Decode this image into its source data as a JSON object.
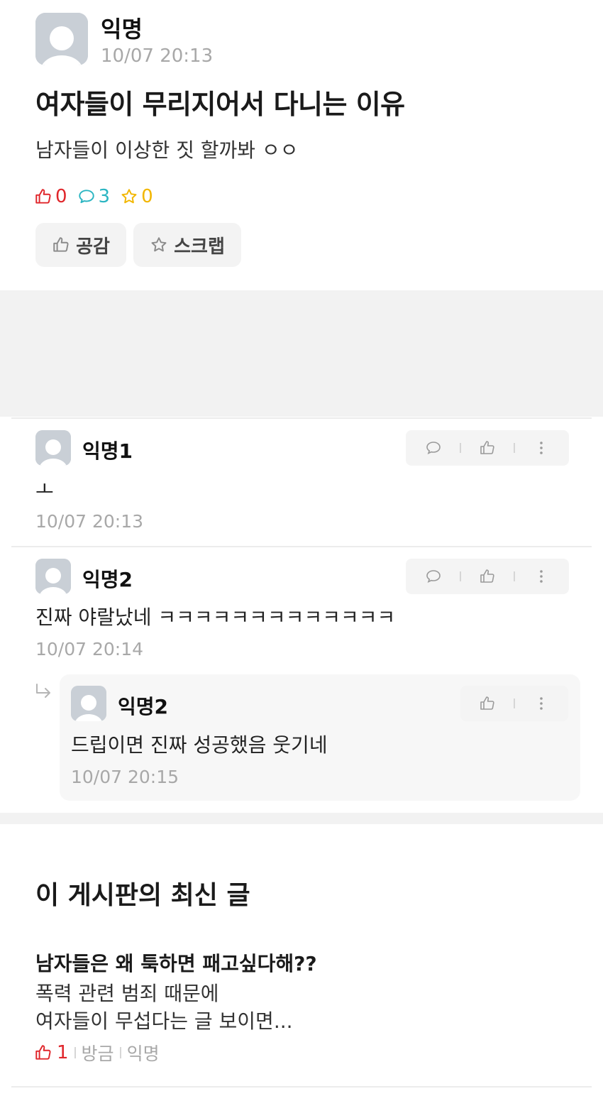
{
  "post": {
    "author": "익명",
    "time": "10/07 20:13",
    "title": "여자들이 무리지어서 다니는 이유",
    "body": "남자들이 이상한 짓 할까봐 ㅇㅇ",
    "likes": "0",
    "comments": "3",
    "scraps": "0",
    "like_button": "공감",
    "scrap_button": "스크랩"
  },
  "comments": [
    {
      "name": "익명1",
      "text": "ㅗ",
      "time": "10/07 20:13"
    },
    {
      "name": "익명2",
      "text": "진짜 야랄났네 ㅋㅋㅋㅋㅋㅋㅋㅋㅋㅋㅋㅋㅋ",
      "time": "10/07 20:14"
    }
  ],
  "reply": {
    "name": "익명2",
    "text": "드립이면 진짜 성공했음 웃기네",
    "time": "10/07 20:15"
  },
  "latest": {
    "section_title": "이 게시판의 최신 글",
    "title": "남자들은 왜 툭하면 패고싶다해??",
    "line1": "폭력 관련 범죄 때문에",
    "line2": "여자들이 무섭다는 글 보이면...",
    "likes": "1",
    "time": "방금",
    "author": "익명"
  },
  "colors": {
    "like": "#e0262b",
    "comment": "#2bb5c2",
    "scrap": "#f2b600"
  },
  "icons": [
    "thumbs-up-icon",
    "speech-bubble-icon",
    "star-icon",
    "more-vertical-icon",
    "reply-arrow-icon",
    "avatar-icon"
  ]
}
